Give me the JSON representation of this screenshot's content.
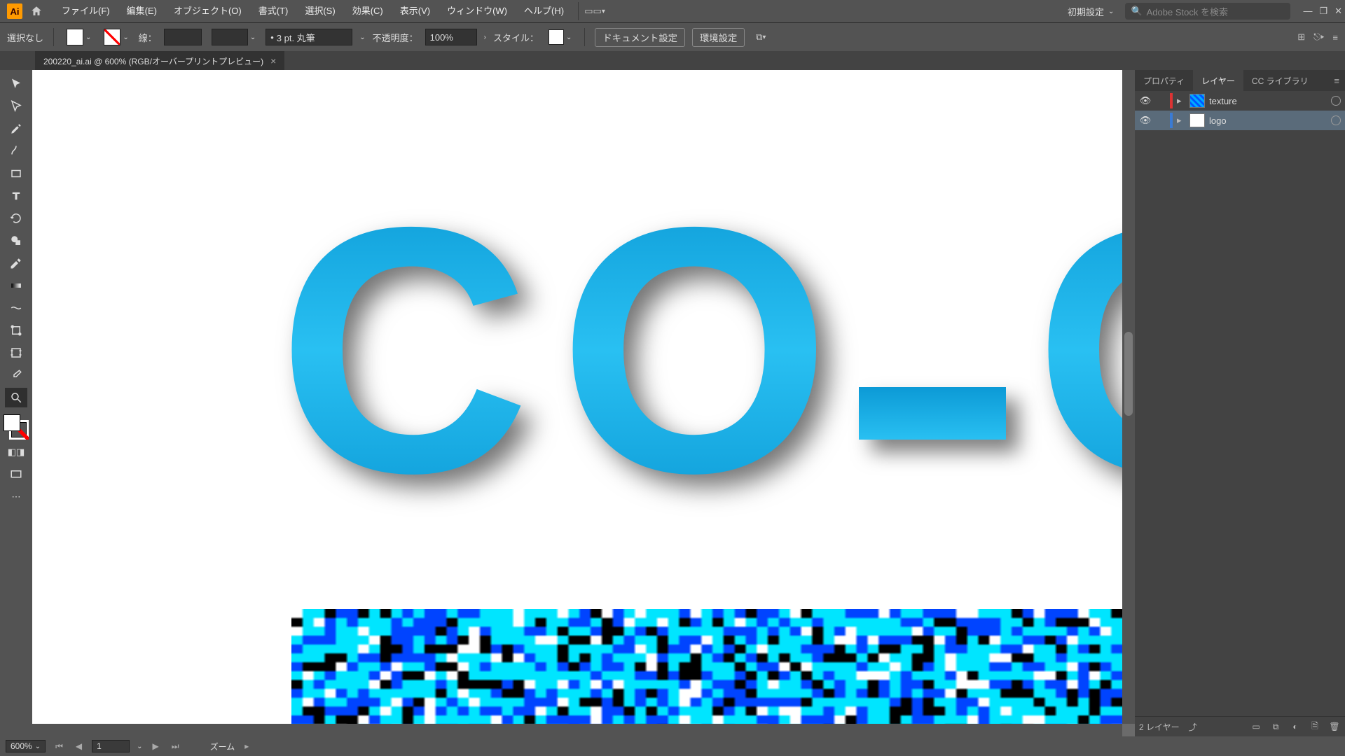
{
  "app": {
    "logo_text": "Ai"
  },
  "menus": {
    "file": "ファイル(F)",
    "edit": "編集(E)",
    "object": "オブジェクト(O)",
    "type": "書式(T)",
    "select": "選択(S)",
    "effect": "効果(C)",
    "view": "表示(V)",
    "window": "ウィンドウ(W)",
    "help": "ヘルプ(H)"
  },
  "header": {
    "workspace": "初期設定",
    "search_placeholder": "Adobe Stock を検索"
  },
  "control": {
    "selection_label": "選択なし",
    "stroke_label": "線：",
    "stroke_weight": "",
    "brush_label": "3 pt. 丸筆",
    "opacity_label": "不透明度：",
    "opacity_value": "100%",
    "style_label": "スタイル：",
    "doc_setup": "ドキュメント設定",
    "prefs": "環境設定"
  },
  "document": {
    "tab_title": "200220_ai.ai @ 600% (RGB/オーバープリントプレビュー)"
  },
  "panels": {
    "tab_properties": "プロパティ",
    "tab_layers": "レイヤー",
    "tab_cclib": "CC ライブラリ"
  },
  "layers": [
    {
      "name": "texture",
      "selected": false,
      "color": "red"
    },
    {
      "name": "logo",
      "selected": true,
      "color": "blue"
    }
  ],
  "layers_footer": {
    "count_label": "2 レイヤー"
  },
  "status": {
    "zoom": "600%",
    "artboard": "1",
    "tool_label": "ズーム"
  }
}
